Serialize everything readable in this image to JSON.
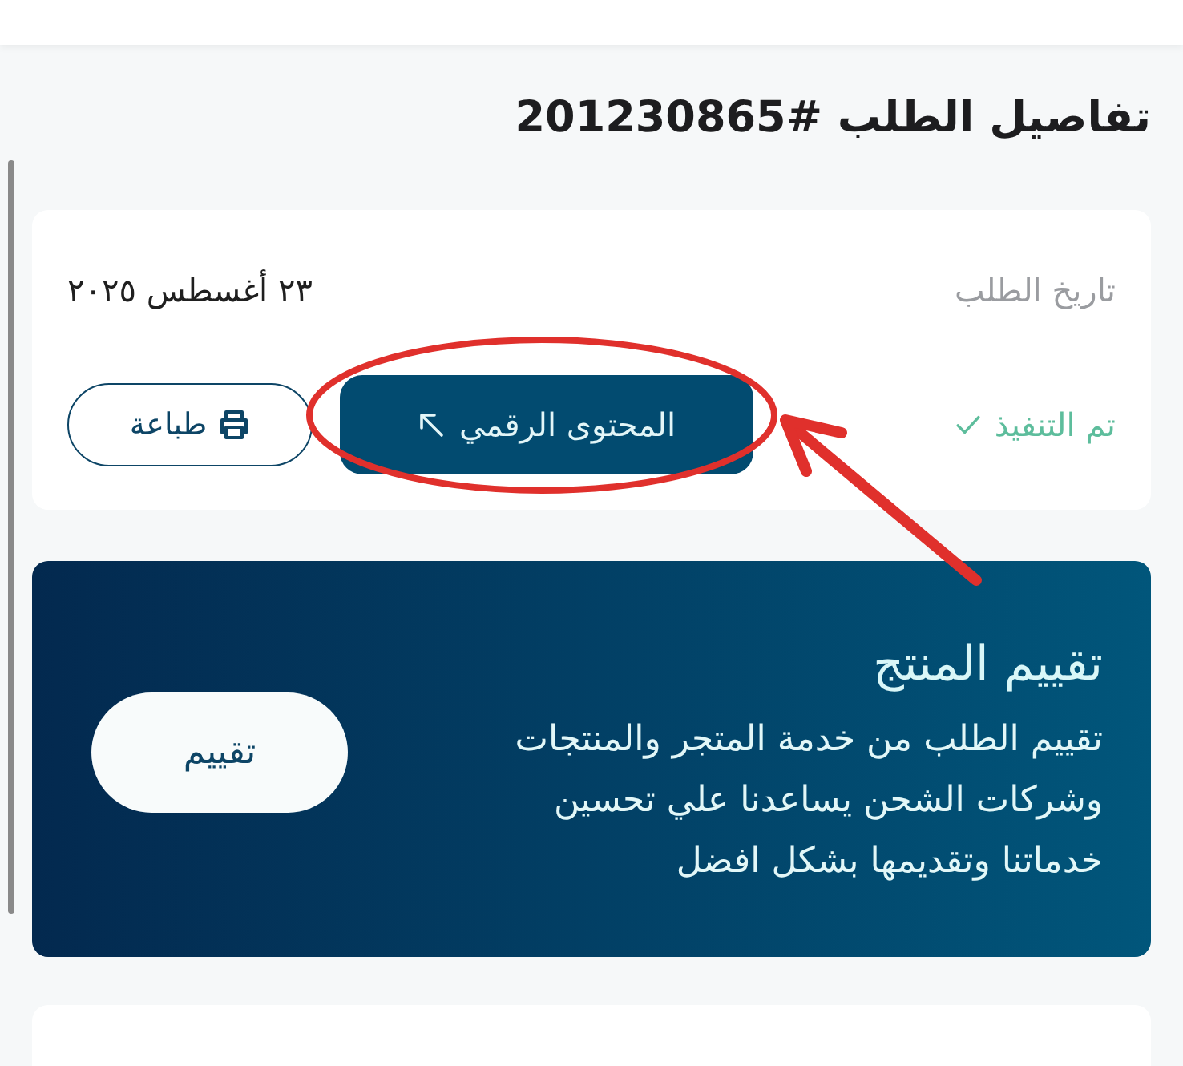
{
  "page": {
    "title": "تفاصيل الطلب #201230865"
  },
  "order_card": {
    "date_label": "تاريخ الطلب",
    "date_value": "٢٣ أغسطس ٢٠٢٥",
    "status": {
      "label": "تم التنفيذ",
      "kind": "completed"
    },
    "buttons": [
      {
        "label": "المحتوى الرقمي",
        "kind": "primary"
      },
      {
        "label": "طباعة",
        "kind": "print"
      }
    ]
  },
  "rating_banner": {
    "title": "تقييم المنتج",
    "description": "تقييم الطلب من خدمة المتجر والمنتجات وشركات الشحن يساعدنا علي تحسين خدماتنا وتقديمها بشكل افضل",
    "button": "تقييم"
  }
}
